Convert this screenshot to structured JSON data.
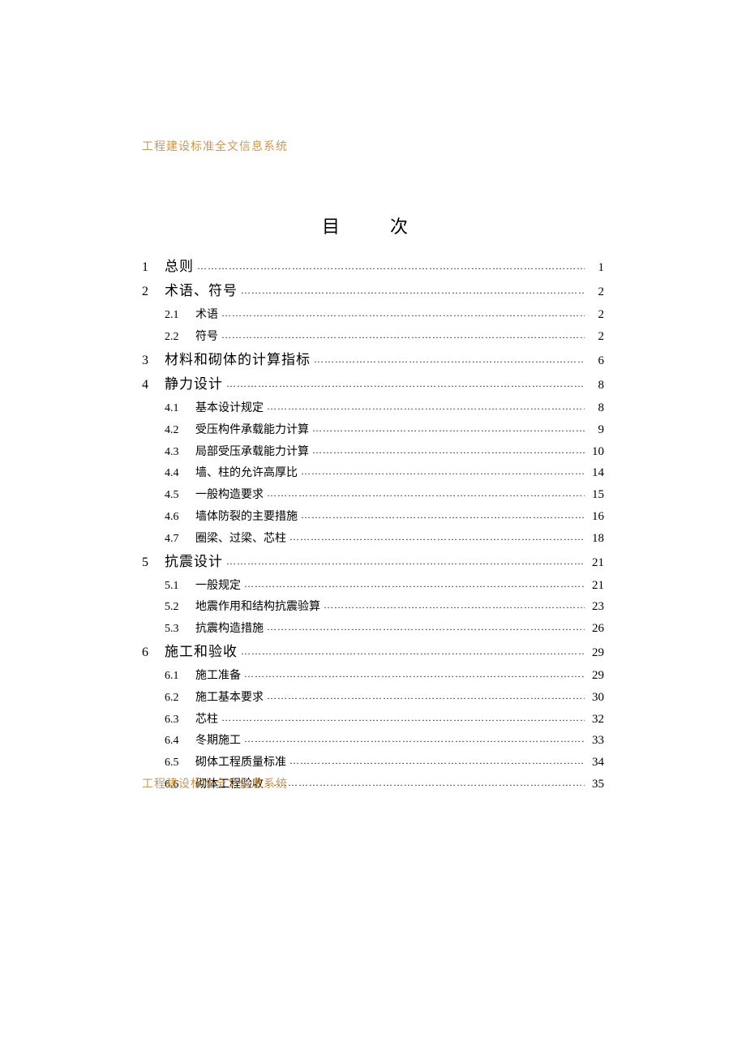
{
  "header": "工程建设标准全文信息系统",
  "footer": "工程建设标准全文信息系统",
  "toc_title": "目　次",
  "toc": [
    {
      "level": "main",
      "num": "1",
      "title": "总则",
      "page": "1"
    },
    {
      "level": "main",
      "num": "2",
      "title": "术语、符号",
      "page": "2"
    },
    {
      "level": "sub",
      "num": "2.1",
      "title": "术语",
      "page": "2"
    },
    {
      "level": "sub",
      "num": "2.2",
      "title": "符号",
      "page": "2"
    },
    {
      "level": "main",
      "num": "3",
      "title": "材料和砌体的计算指标",
      "page": "6"
    },
    {
      "level": "main",
      "num": "4",
      "title": "静力设计",
      "page": "8"
    },
    {
      "level": "sub",
      "num": "4.1",
      "title": "基本设计规定",
      "page": "8"
    },
    {
      "level": "sub",
      "num": "4.2",
      "title": "受压构件承载能力计算",
      "page": "9"
    },
    {
      "level": "sub",
      "num": "4.3",
      "title": "局部受压承载能力计算",
      "page": "10"
    },
    {
      "level": "sub",
      "num": "4.4",
      "title": "墙、柱的允许高厚比",
      "page": "14"
    },
    {
      "level": "sub",
      "num": "4.5",
      "title": "一般构造要求",
      "page": "15"
    },
    {
      "level": "sub",
      "num": "4.6",
      "title": "墙体防裂的主要措施",
      "page": "16"
    },
    {
      "level": "sub",
      "num": "4.7",
      "title": "圈梁、过梁、芯柱",
      "page": "18"
    },
    {
      "level": "main",
      "num": "5",
      "title": "抗震设计",
      "page": "21"
    },
    {
      "level": "sub",
      "num": "5.1",
      "title": "一般规定",
      "page": "21"
    },
    {
      "level": "sub",
      "num": "5.2",
      "title": "地震作用和结构抗震验算",
      "page": "23"
    },
    {
      "level": "sub",
      "num": "5.3",
      "title": "抗震构造措施",
      "page": "26"
    },
    {
      "level": "main",
      "num": "6",
      "title": "施工和验收",
      "page": "29"
    },
    {
      "level": "sub",
      "num": "6.1",
      "title": "施工准备",
      "page": "29"
    },
    {
      "level": "sub",
      "num": "6.2",
      "title": "施工基本要求",
      "page": "30"
    },
    {
      "level": "sub",
      "num": "6.3",
      "title": "芯柱",
      "page": "32"
    },
    {
      "level": "sub",
      "num": "6.4",
      "title": "冬期施工",
      "page": "33"
    },
    {
      "level": "sub",
      "num": "6.5",
      "title": "砌体工程质量标准",
      "page": "34"
    },
    {
      "level": "sub",
      "num": "6.6",
      "title": "砌体工程验收",
      "page": "35"
    }
  ]
}
